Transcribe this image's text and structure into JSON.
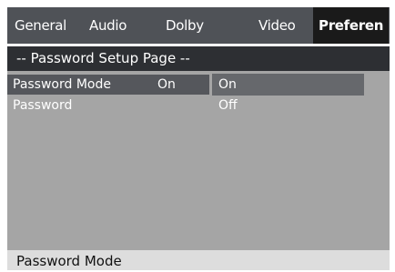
{
  "tabs": {
    "general": "General",
    "audio": "Audio",
    "dolby": "Dolby",
    "video": "Video",
    "preferences": "Preferen"
  },
  "page_header": "-- Password Setup Page --",
  "rows": [
    {
      "label": "Password Mode",
      "value": "On"
    },
    {
      "label": "Password",
      "value": ""
    }
  ],
  "options": [
    "On",
    "Off"
  ],
  "status_text": "Password Mode",
  "colors": {
    "tabbar": "#4f5257",
    "active_tab": "#1a1a1a",
    "header": "#2d2f33",
    "content": "#a5a5a5",
    "selected_row": "#55575c",
    "selected_option": "#66686c",
    "statusbar": "#dddddd"
  }
}
